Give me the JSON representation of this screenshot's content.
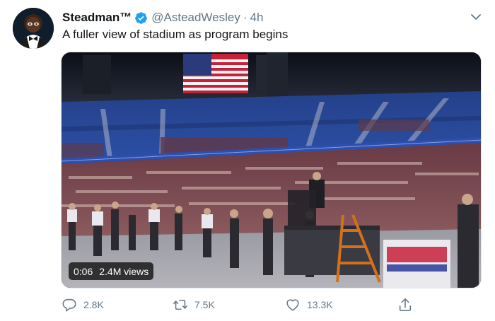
{
  "tweet": {
    "display_name": "Steadman™",
    "handle": "@AsteadWesley",
    "separator": "·",
    "time": "4h",
    "text": "A fuller view of stadium as program begins",
    "verified": true
  },
  "video": {
    "elapsed": "0:06",
    "views": "2.4M views"
  },
  "actions": {
    "reply": {
      "icon": "reply-icon",
      "count": "2.8K"
    },
    "retweet": {
      "icon": "retweet-icon",
      "count": "7.5K"
    },
    "like": {
      "icon": "heart-icon",
      "count": "13.3K"
    },
    "share": {
      "icon": "share-icon"
    }
  },
  "colors": {
    "verified_blue": "#1da1f2",
    "secondary_text": "#657786",
    "primary_text": "#14171a"
  }
}
